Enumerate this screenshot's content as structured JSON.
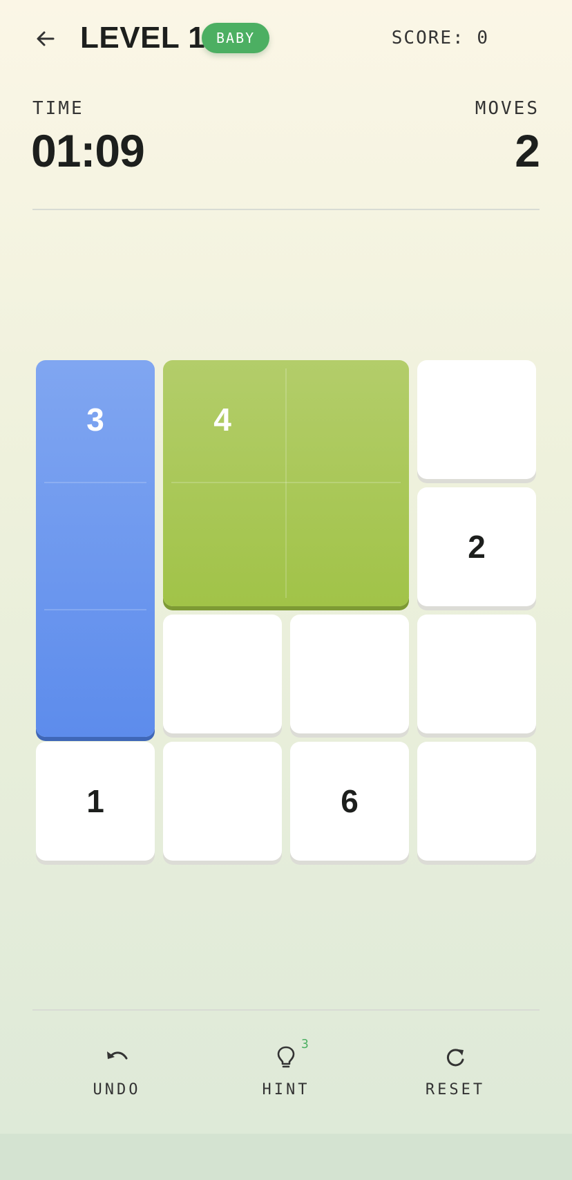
{
  "header": {
    "title": "LEVEL 1",
    "badge": "BABY",
    "score": "SCORE: 0",
    "back_icon": "arrow-left-icon"
  },
  "stats": {
    "time_label": "TIME",
    "time_value": "01:09",
    "moves_label": "MOVES",
    "moves_value": "2"
  },
  "board": {
    "rows": 4,
    "cols": 4,
    "blocks": [
      {
        "label": "3",
        "color": "#6a97ef",
        "cells": "col 1, rows 1-3"
      },
      {
        "label": "4",
        "color": "#a9c95a",
        "cells": "cols 2-3, rows 1-2"
      }
    ],
    "cells": {
      "r1c4": "",
      "r2c4": "2",
      "r3c2": "",
      "r3c3": "",
      "r3c4": "",
      "r4c1": "1",
      "r4c2": "",
      "r4c3": "6",
      "r4c4": ""
    }
  },
  "controls": {
    "undo_label": "UNDO",
    "undo_icon": "undo-icon",
    "hint_label": "HINT",
    "hint_icon": "lightbulb-icon",
    "hint_count": "3",
    "reset_label": "RESET",
    "reset_icon": "reset-icon"
  },
  "colors": {
    "accent_green": "#4caf62",
    "block_blue": "#6a97ef",
    "block_green": "#a9c95a"
  }
}
